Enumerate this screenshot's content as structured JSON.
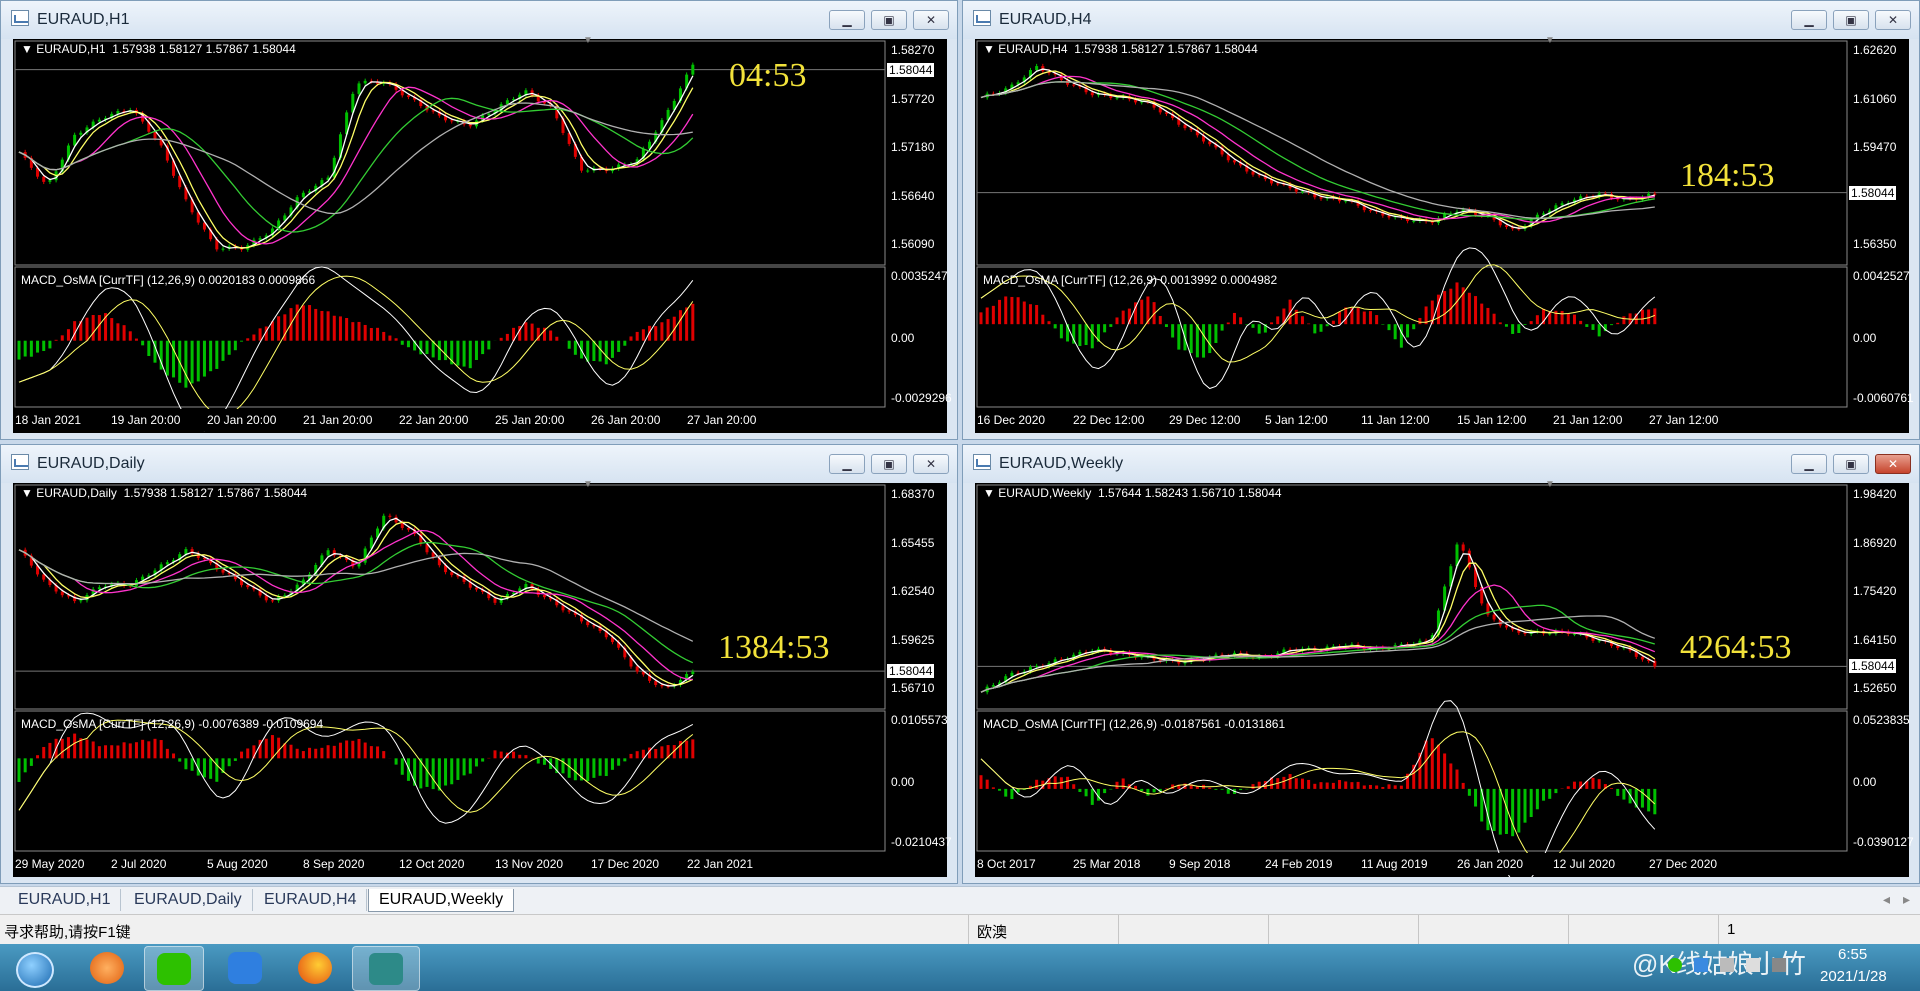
{
  "windows": [
    {
      "id": "h1",
      "title": "EURAUD,H1",
      "pair": "EURAUD,H1",
      "ohlc": "1.57938 1.58127 1.57867 1.58044",
      "price_ticks": [
        "1.58270",
        "1.57720",
        "1.57180",
        "1.56640",
        "1.56090"
      ],
      "current_price": "1.58044",
      "macd_label": "MACD_OsMA [CurrTF] (12,26,9) 0.0020183 0.0009866",
      "macd_ticks": [
        "0.0035247",
        "0.00",
        "-0.0029296"
      ],
      "dates": [
        "18 Jan 2021",
        "19 Jan 20:00",
        "20 Jan 20:00",
        "21 Jan 20:00",
        "22 Jan 20:00",
        "25 Jan 20:00",
        "26 Jan 20:00",
        "27 Jan 20:00"
      ],
      "timer": "04:53",
      "buttons": {
        "min": "▁",
        "max": "▣",
        "close": "✕"
      },
      "chart_data": {
        "type": "candlestick",
        "ylim": [
          1.5585,
          1.5835
        ],
        "current": 1.58044,
        "points": [
          1.571,
          1.567,
          1.573,
          1.575,
          1.576,
          1.572,
          1.565,
          1.56,
          1.56,
          1.562,
          1.566,
          1.568,
          1.579,
          1.579,
          1.577,
          1.575,
          1.574,
          1.576,
          1.578,
          1.576,
          1.569,
          1.569,
          1.57,
          1.575,
          1.581
        ],
        "macd_ylim": [
          -0.0032,
          0.0037
        ],
        "hist": [
          -0.001,
          -0.0005,
          0.001,
          0.0015,
          0.0005,
          -0.0015,
          -0.0025,
          -0.0015,
          0,
          0.001,
          0.002,
          0.0015,
          0.001,
          0.0005,
          -0.0005,
          -0.001,
          -0.0015,
          0,
          0.001,
          0.0005,
          -0.001,
          -0.0012,
          0.0005,
          0.001,
          0.002
        ]
      }
    },
    {
      "id": "h4",
      "title": "EURAUD,H4",
      "pair": "EURAUD,H4",
      "ohlc": "1.57938 1.58127 1.57867 1.58044",
      "price_ticks": [
        "1.62620",
        "1.61060",
        "1.59470",
        "1.57910",
        "1.56350"
      ],
      "current_price": "1.58044",
      "macd_label": "MACD_OsMA [CurrTF] (12,26,9) 0.0013992 0.0004982",
      "macd_ticks": [
        "0.0042527",
        "0.00",
        "-0.0060761"
      ],
      "dates": [
        "16 Dec 2020",
        "22 Dec 12:00",
        "29 Dec 12:00",
        "5 Jan 12:00",
        "11 Jan 12:00",
        "15 Jan 12:00",
        "21 Jan 12:00",
        "27 Jan 12:00"
      ],
      "timer": "184:53",
      "buttons": {
        "min": "▁",
        "max": "▣",
        "close": "✕"
      },
      "chart_data": {
        "type": "candlestick",
        "ylim": [
          1.5585,
          1.6285
        ],
        "current": 1.58044,
        "points": [
          1.611,
          1.614,
          1.621,
          1.616,
          1.612,
          1.611,
          1.609,
          1.603,
          1.597,
          1.59,
          1.585,
          1.582,
          1.579,
          1.578,
          1.574,
          1.572,
          1.571,
          1.575,
          1.573,
          1.568,
          1.574,
          1.578,
          1.58,
          1.578,
          1.58
        ],
        "macd_ylim": [
          -0.0065,
          0.0045
        ],
        "hist": [
          0.001,
          0.0025,
          0.0015,
          -0.0015,
          -0.002,
          0.001,
          0.0025,
          -0.002,
          -0.003,
          0.001,
          -0.001,
          0.002,
          -0.001,
          0.0015,
          0.001,
          -0.002,
          0.002,
          0.0035,
          0.0015,
          -0.001,
          0.0012,
          0.001,
          -0.001,
          0.0008,
          0.0014
        ]
      }
    },
    {
      "id": "daily",
      "title": "EURAUD,Daily",
      "pair": "EURAUD,Daily",
      "ohlc": "1.57938 1.58127 1.57867 1.58044",
      "price_ticks": [
        "1.68370",
        "1.65455",
        "1.62540",
        "1.59625",
        "1.56710"
      ],
      "current_price": "1.58044",
      "macd_label": "MACD_OsMA [CurrTF] (12,26,9) -0.0076389 -0.0109694",
      "macd_ticks": [
        "0.0105573",
        "0.00",
        "-0.0210437"
      ],
      "dates": [
        "29 May 2020",
        "2 Jul 2020",
        "5 Aug 2020",
        "8 Sep 2020",
        "12 Oct 2020",
        "13 Nov 2020",
        "17 Dec 2020",
        "22 Jan 2021"
      ],
      "timer": "1384:53",
      "buttons": {
        "min": "▁",
        "max": "▣",
        "close": "✕"
      },
      "chart_data": {
        "type": "candlestick",
        "ylim": [
          1.561,
          1.686
        ],
        "current": 1.58044,
        "points": [
          1.65,
          1.63,
          1.62,
          1.63,
          1.63,
          1.64,
          1.65,
          1.64,
          1.63,
          1.62,
          1.63,
          1.65,
          1.64,
          1.67,
          1.66,
          1.64,
          1.63,
          1.62,
          1.63,
          1.62,
          1.61,
          1.6,
          1.58,
          1.57,
          1.58
        ],
        "macd_ylim": [
          -0.022,
          0.011
        ],
        "hist": [
          -0.006,
          0.004,
          0.006,
          0.003,
          0.004,
          0.005,
          -0.003,
          -0.006,
          0.002,
          0.006,
          0.002,
          0.003,
          0.005,
          0.002,
          -0.007,
          -0.008,
          -0.004,
          0.002,
          0.001,
          -0.003,
          -0.006,
          -0.004,
          0.002,
          0.003,
          0.005
        ]
      }
    },
    {
      "id": "weekly",
      "title": "EURAUD,Weekly",
      "pair": "EURAUD,Weekly",
      "ohlc": "1.57644 1.58243 1.56710 1.58044",
      "price_ticks": [
        "1.98420",
        "1.86920",
        "1.75420",
        "1.64150",
        "1.52650"
      ],
      "current_price": "1.58044",
      "macd_label": "MACD_OsMA [CurrTF] (12,26,9) -0.0187561 -0.0131861",
      "macd_ticks": [
        "0.0523835",
        "0.00",
        "-0.0390127"
      ],
      "dates": [
        "8 Oct 2017",
        "25 Mar 2018",
        "9 Sep 2018",
        "24 Feb 2019",
        "11 Aug 2019",
        "26 Jan 2020",
        "12 Jul 2020",
        "27 Dec 2020"
      ],
      "timer": "4264:53",
      "buttons": {
        "min": "▁",
        "max": "▣",
        "close": "✕"
      },
      "chart_data": {
        "type": "candlestick",
        "ylim": [
          1.49,
          2.0
        ],
        "current": 1.58044,
        "points": [
          1.52,
          1.56,
          1.58,
          1.6,
          1.62,
          1.61,
          1.6,
          1.59,
          1.6,
          1.61,
          1.6,
          1.62,
          1.62,
          1.63,
          1.62,
          1.63,
          1.64,
          1.88,
          1.7,
          1.66,
          1.66,
          1.66,
          1.64,
          1.62,
          1.58
        ],
        "macd_ylim": [
          -0.041,
          0.054
        ],
        "hist": [
          0.01,
          -0.008,
          0.006,
          0.01,
          -0.012,
          0.008,
          -0.005,
          0.004,
          0.002,
          -0.004,
          0.006,
          0.01,
          0.004,
          0.006,
          0.002,
          0.003,
          0.04,
          0.012,
          -0.03,
          -0.035,
          -0.01,
          0.004,
          0.008,
          -0.01,
          -0.018
        ]
      }
    }
  ],
  "tabs": [
    "EURAUD,H1",
    "EURAUD,Daily",
    "EURAUD,H4",
    "EURAUD,Weekly"
  ],
  "active_tab": "EURAUD,Weekly",
  "status": {
    "help": "寻求帮助,请按F1键",
    "profile": "欧澳",
    "extra": "1"
  },
  "taskbar": {
    "time": "6:55",
    "date": "2021/1/28",
    "watermark": "@K线姑娘小竹"
  },
  "colors": {
    "bull": "#00c000",
    "bear": "#e00000",
    "ma_yellow": "#ffff66",
    "ma_white": "#ffffff",
    "ma_magenta": "#ff33cc",
    "ma_green": "#33cc33",
    "ma_gray": "#b0b0b0",
    "timer": "#f2e23a"
  }
}
